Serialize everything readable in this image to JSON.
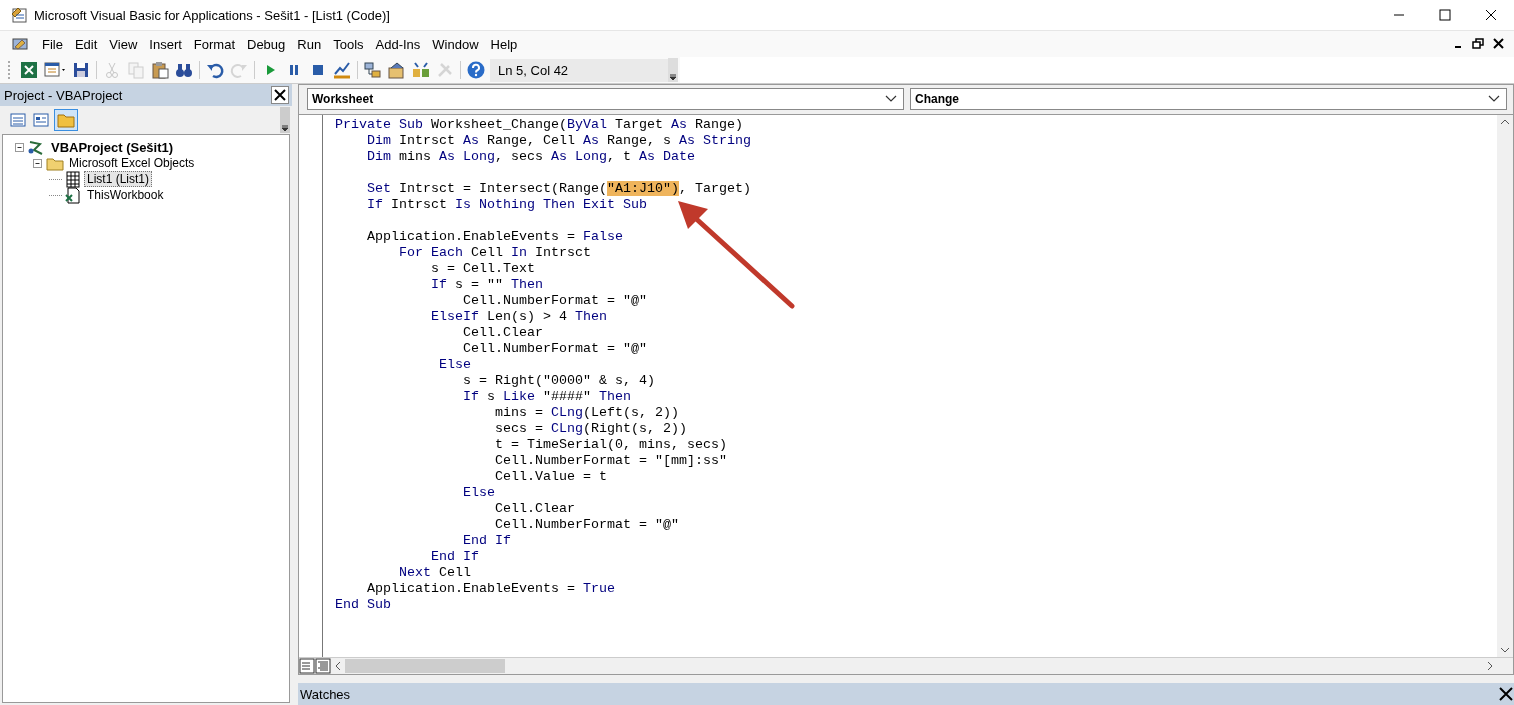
{
  "window": {
    "title": "Microsoft Visual Basic for Applications - Sešit1 - [List1 (Code)]"
  },
  "menu": [
    "File",
    "Edit",
    "View",
    "Insert",
    "Format",
    "Debug",
    "Run",
    "Tools",
    "Add-Ins",
    "Window",
    "Help"
  ],
  "toolbar": {
    "buttons": [
      {
        "kind": "excel",
        "disabled": false
      },
      {
        "kind": "form",
        "disabled": false
      },
      {
        "kind": "save",
        "disabled": false
      },
      {
        "kind": "sep"
      },
      {
        "kind": "cut",
        "disabled": true
      },
      {
        "kind": "copy",
        "disabled": true
      },
      {
        "kind": "paste",
        "disabled": false
      },
      {
        "kind": "find",
        "disabled": false
      },
      {
        "kind": "sep"
      },
      {
        "kind": "undo",
        "disabled": false
      },
      {
        "kind": "redo",
        "disabled": true
      },
      {
        "kind": "sep"
      },
      {
        "kind": "run",
        "disabled": false
      },
      {
        "kind": "pause",
        "disabled": false
      },
      {
        "kind": "stop",
        "disabled": false
      },
      {
        "kind": "design",
        "disabled": false
      },
      {
        "kind": "sep"
      },
      {
        "kind": "project",
        "disabled": false
      },
      {
        "kind": "properties",
        "disabled": false
      },
      {
        "kind": "browser",
        "disabled": false
      },
      {
        "kind": "toolbox",
        "disabled": true
      },
      {
        "kind": "sep"
      },
      {
        "kind": "help",
        "disabled": false
      }
    ],
    "position": "Ln 5, Col 42"
  },
  "project_panel": {
    "title": "Project - VBAProject",
    "tree": [
      {
        "label": "VBAProject (Sešit1)",
        "kind": "project",
        "expanded": true,
        "selected": false,
        "children": [
          {
            "label": "Microsoft Excel Objects",
            "kind": "folder",
            "expanded": true,
            "selected": false,
            "children": [
              {
                "label": "List1 (List1)",
                "kind": "sheet",
                "selected": true
              },
              {
                "label": "ThisWorkbook",
                "kind": "workbook",
                "selected": false
              }
            ]
          }
        ]
      }
    ]
  },
  "code_window": {
    "object": "Worksheet",
    "procedure": "Change",
    "lines": [
      {
        "kind": "code",
        "segments": [
          {
            "text": "Private Sub",
            "kind": "keyword"
          },
          {
            "text": " Worksheet_Change(",
            "kind": "plain"
          },
          {
            "text": "ByVal",
            "kind": "keyword"
          },
          {
            "text": " Target ",
            "kind": "plain"
          },
          {
            "text": "As",
            "kind": "keyword"
          },
          {
            "text": " Range)",
            "kind": "plain"
          }
        ]
      },
      {
        "kind": "code",
        "segments": [
          {
            "text": "    Dim",
            "kind": "keyword"
          },
          {
            "text": " Intrsct ",
            "kind": "plain"
          },
          {
            "text": "As",
            "kind": "keyword"
          },
          {
            "text": " Range, Cell ",
            "kind": "plain"
          },
          {
            "text": "As",
            "kind": "keyword"
          },
          {
            "text": " Range, s ",
            "kind": "plain"
          },
          {
            "text": "As String",
            "kind": "keyword"
          }
        ]
      },
      {
        "kind": "code",
        "segments": [
          {
            "text": "    Dim",
            "kind": "keyword"
          },
          {
            "text": " mins ",
            "kind": "plain"
          },
          {
            "text": "As Long",
            "kind": "keyword"
          },
          {
            "text": ", secs ",
            "kind": "plain"
          },
          {
            "text": "As Long",
            "kind": "keyword"
          },
          {
            "text": ", t ",
            "kind": "plain"
          },
          {
            "text": "As Date",
            "kind": "keyword"
          }
        ]
      },
      {
        "kind": "blank"
      },
      {
        "kind": "code",
        "segments": [
          {
            "text": "    Set",
            "kind": "keyword"
          },
          {
            "text": " Intrsct = Intersect(Range(",
            "kind": "plain"
          },
          {
            "text": "\"A1:J10\")",
            "kind": "highlight"
          },
          {
            "text": ", Target)",
            "kind": "plain"
          }
        ]
      },
      {
        "kind": "code",
        "segments": [
          {
            "text": "    If",
            "kind": "keyword"
          },
          {
            "text": " Intrsct ",
            "kind": "plain"
          },
          {
            "text": "Is Nothing Then Exit Sub",
            "kind": "keyword"
          }
        ]
      },
      {
        "kind": "blank"
      },
      {
        "kind": "code",
        "segments": [
          {
            "text": "    Application.EnableEvents = ",
            "kind": "plain"
          },
          {
            "text": "False",
            "kind": "keyword"
          }
        ]
      },
      {
        "kind": "code",
        "segments": [
          {
            "text": "        For Each",
            "kind": "keyword"
          },
          {
            "text": " Cell ",
            "kind": "plain"
          },
          {
            "text": "In",
            "kind": "keyword"
          },
          {
            "text": " Intrsct",
            "kind": "plain"
          }
        ]
      },
      {
        "kind": "code",
        "segments": [
          {
            "text": "            s = Cell.Text",
            "kind": "plain"
          }
        ]
      },
      {
        "kind": "code",
        "segments": [
          {
            "text": "            If",
            "kind": "keyword"
          },
          {
            "text": " s = \"\" ",
            "kind": "plain"
          },
          {
            "text": "Then",
            "kind": "keyword"
          }
        ]
      },
      {
        "kind": "code",
        "segments": [
          {
            "text": "                Cell.NumberFormat = \"@\"",
            "kind": "plain"
          }
        ]
      },
      {
        "kind": "code",
        "segments": [
          {
            "text": "            ElseIf",
            "kind": "keyword"
          },
          {
            "text": " Len(s) > 4 ",
            "kind": "plain"
          },
          {
            "text": "Then",
            "kind": "keyword"
          }
        ]
      },
      {
        "kind": "code",
        "segments": [
          {
            "text": "                Cell.Clear",
            "kind": "plain"
          }
        ]
      },
      {
        "kind": "code",
        "segments": [
          {
            "text": "                Cell.NumberFormat = \"@\"",
            "kind": "plain"
          }
        ]
      },
      {
        "kind": "code",
        "segments": [
          {
            "text": "             Else",
            "kind": "keyword"
          }
        ]
      },
      {
        "kind": "code",
        "segments": [
          {
            "text": "                s = Right(\"0000\" & s, 4)",
            "kind": "plain"
          }
        ]
      },
      {
        "kind": "code",
        "segments": [
          {
            "text": "                If",
            "kind": "keyword"
          },
          {
            "text": " s ",
            "kind": "plain"
          },
          {
            "text": "Like",
            "kind": "keyword"
          },
          {
            "text": " \"####\" ",
            "kind": "plain"
          },
          {
            "text": "Then",
            "kind": "keyword"
          }
        ]
      },
      {
        "kind": "code",
        "segments": [
          {
            "text": "                    mins = ",
            "kind": "plain"
          },
          {
            "text": "CLng",
            "kind": "keyword"
          },
          {
            "text": "(Left(s, 2))",
            "kind": "plain"
          }
        ]
      },
      {
        "kind": "code",
        "segments": [
          {
            "text": "                    secs = ",
            "kind": "plain"
          },
          {
            "text": "CLng",
            "kind": "keyword"
          },
          {
            "text": "(Right(s, 2))",
            "kind": "plain"
          }
        ]
      },
      {
        "kind": "code",
        "segments": [
          {
            "text": "                    t = TimeSerial(0, mins, secs)",
            "kind": "plain"
          }
        ]
      },
      {
        "kind": "code",
        "segments": [
          {
            "text": "                    Cell.NumberFormat = \"[mm]:ss\"",
            "kind": "plain"
          }
        ]
      },
      {
        "kind": "code",
        "segments": [
          {
            "text": "                    Cell.Value = t",
            "kind": "plain"
          }
        ]
      },
      {
        "kind": "code",
        "segments": [
          {
            "text": "                Else",
            "kind": "keyword"
          }
        ]
      },
      {
        "kind": "code",
        "segments": [
          {
            "text": "                    Cell.Clear",
            "kind": "plain"
          }
        ]
      },
      {
        "kind": "code",
        "segments": [
          {
            "text": "                    Cell.NumberFormat = \"@\"",
            "kind": "plain"
          }
        ]
      },
      {
        "kind": "code",
        "segments": [
          {
            "text": "                End If",
            "kind": "keyword"
          }
        ]
      },
      {
        "kind": "code",
        "segments": [
          {
            "text": "            End If",
            "kind": "keyword"
          }
        ]
      },
      {
        "kind": "code",
        "segments": [
          {
            "text": "        Next",
            "kind": "keyword"
          },
          {
            "text": " Cell",
            "kind": "plain"
          }
        ]
      },
      {
        "kind": "code",
        "segments": [
          {
            "text": "    Application.EnableEvents = ",
            "kind": "plain"
          },
          {
            "text": "True",
            "kind": "keyword"
          }
        ]
      },
      {
        "kind": "code",
        "segments": [
          {
            "text": "End Sub",
            "kind": "keyword"
          }
        ]
      }
    ]
  },
  "watches": {
    "title": "Watches"
  }
}
